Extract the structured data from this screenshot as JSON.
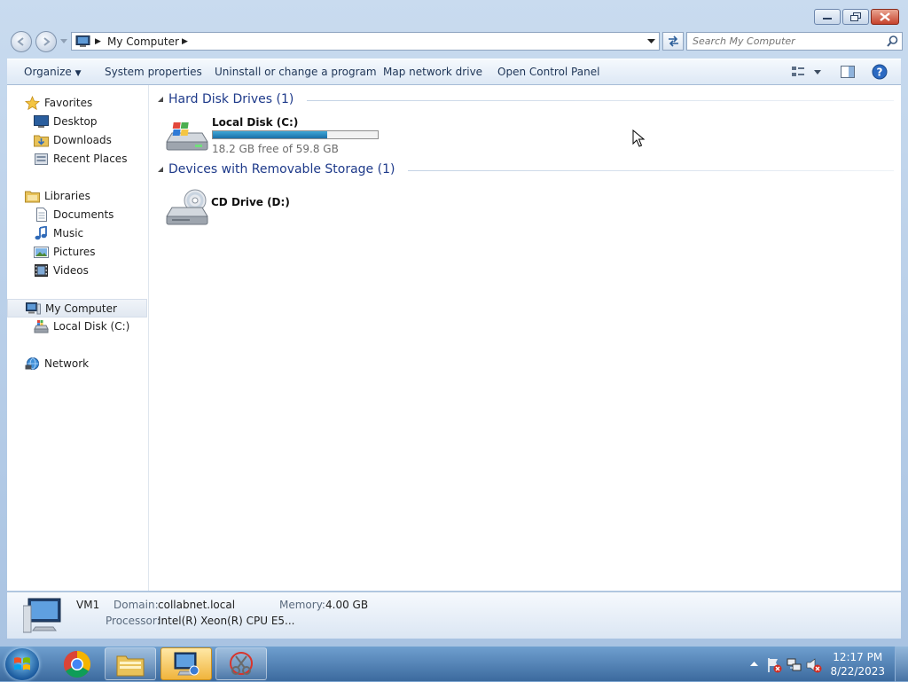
{
  "window": {
    "title": "",
    "caption_buttons": [
      "minimize-icon",
      "restore-icon",
      "close-icon"
    ]
  },
  "nav": {
    "address_crumb": "My Computer",
    "search_placeholder": "Search My Computer"
  },
  "toolbar": {
    "organize": "Organize",
    "system_properties": "System properties",
    "uninstall": "Uninstall or change a program",
    "map_drive": "Map network drive",
    "control_panel": "Open Control Panel"
  },
  "sidebar": {
    "favorites": {
      "label": "Favorites",
      "items": [
        "Desktop",
        "Downloads",
        "Recent Places"
      ]
    },
    "libraries": {
      "label": "Libraries",
      "items": [
        "Documents",
        "Music",
        "Pictures",
        "Videos"
      ]
    },
    "computer": {
      "label": "My Computer",
      "items": [
        "Local Disk (C:)"
      ]
    },
    "network": {
      "label": "Network"
    }
  },
  "main": {
    "groups": [
      {
        "title": "Hard Disk Drives (1)",
        "drives": [
          {
            "name": "Local Disk (C:)",
            "free_text": "18.2 GB free of 59.8 GB",
            "used_fraction": 0.696
          }
        ]
      },
      {
        "title": "Devices with Removable Storage (1)",
        "drives": [
          {
            "name": "CD Drive (D:)"
          }
        ]
      }
    ]
  },
  "details": {
    "name": "VM1",
    "domain_label": "Domain:",
    "domain_value": "collabnet.local",
    "memory_label": "Memory:",
    "memory_value": "4.00 GB",
    "processor_label": "Processor:",
    "processor_value": "Intel(R) Xeon(R) CPU E5..."
  },
  "taskbar": {
    "time": "12:17 PM",
    "date": "8/22/2023"
  },
  "colors": {
    "group_title": "#1e3a8a",
    "bar_fill": "#1a6fa8"
  }
}
